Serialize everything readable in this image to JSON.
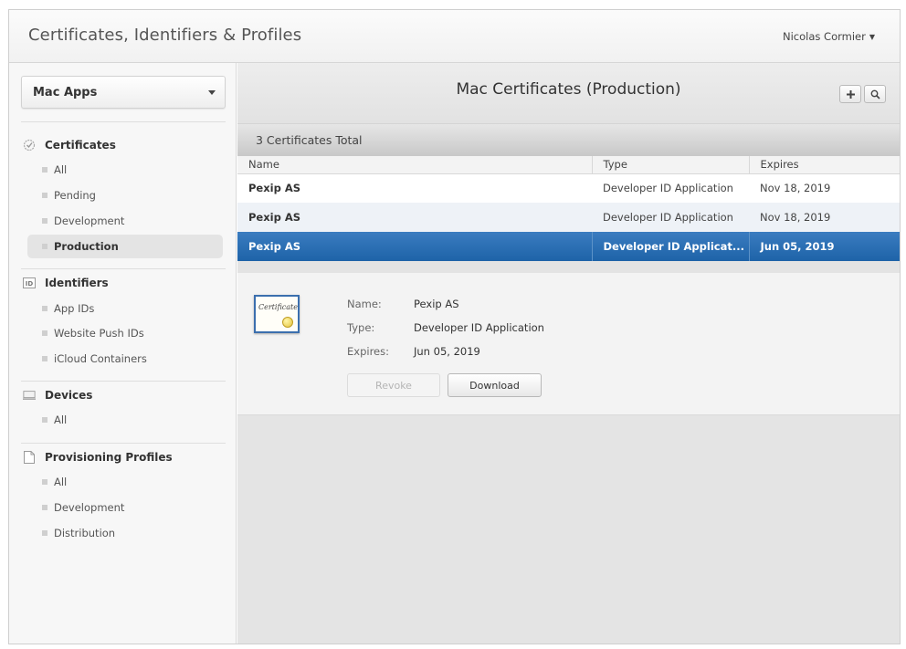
{
  "header": {
    "title": "Certificates, Identifiers & Profiles",
    "user": "Nicolas Cormier"
  },
  "sidebar": {
    "platform": "Mac Apps",
    "sections": [
      {
        "title": "Certificates",
        "icon": "certificate-icon",
        "items": [
          "All",
          "Pending",
          "Development",
          "Production"
        ],
        "active": "Production"
      },
      {
        "title": "Identifiers",
        "icon": "id-icon",
        "items": [
          "App IDs",
          "Website Push IDs",
          "iCloud Containers"
        ]
      },
      {
        "title": "Devices",
        "icon": "device-icon",
        "items": [
          "All"
        ]
      },
      {
        "title": "Provisioning Profiles",
        "icon": "profile-icon",
        "items": [
          "All",
          "Development",
          "Distribution"
        ]
      }
    ]
  },
  "main": {
    "title": "Mac Certificates (Production)",
    "total": "3 Certificates Total",
    "columns": [
      "Name",
      "Type",
      "Expires"
    ],
    "rows": [
      {
        "name": "Pexip AS",
        "type": "Developer ID Application",
        "expires": "Nov 18, 2019"
      },
      {
        "name": "Pexip AS",
        "type": "Developer ID Application",
        "expires": "Nov 18, 2019"
      },
      {
        "name": "Pexip AS",
        "type": "Developer ID Applicat...",
        "expires": "Jun 05, 2019"
      }
    ],
    "detail": {
      "badge_text": "Certificate",
      "name_label": "Name:",
      "name": "Pexip AS",
      "type_label": "Type:",
      "type": "Developer ID Application",
      "expires_label": "Expires:",
      "expires": "Jun 05, 2019",
      "revoke": "Revoke",
      "download": "Download"
    }
  }
}
